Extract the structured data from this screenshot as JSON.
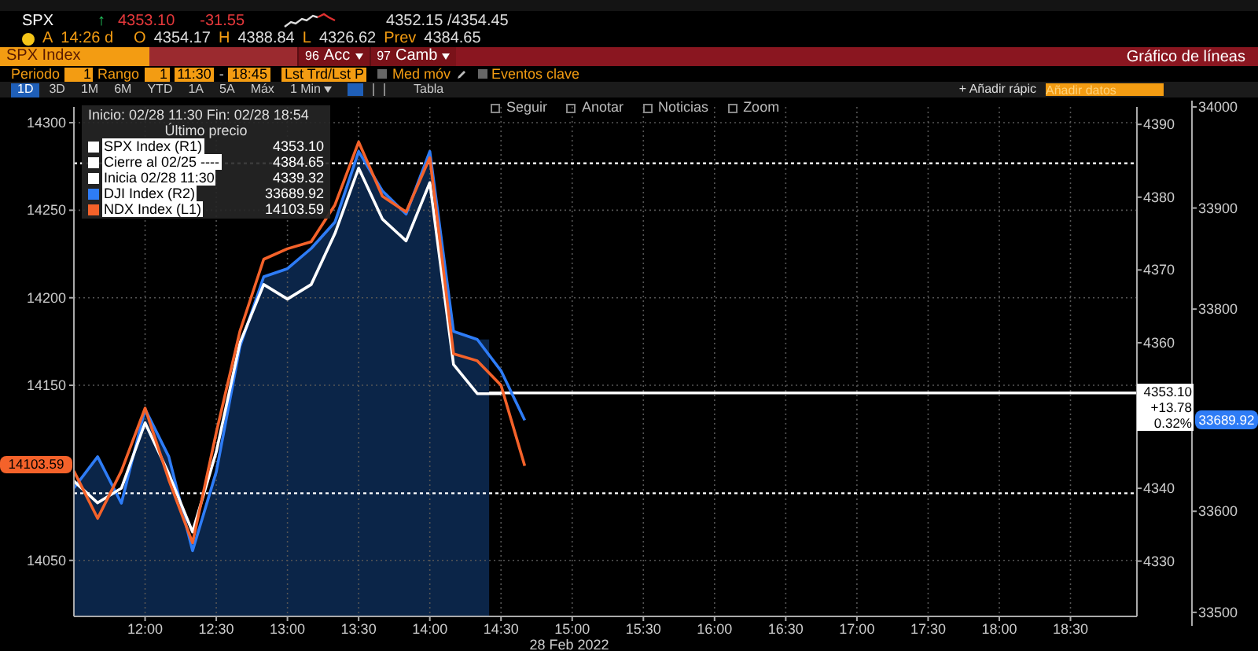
{
  "quote": {
    "ticker": "SPX",
    "arrow": "↑",
    "last": "4353.10",
    "change": "-31.55",
    "bid_ask": "4352.15 /4354.45"
  },
  "quote_details": {
    "source": "A",
    "time": "14:26 d",
    "fields": [
      {
        "label": "O",
        "value": "4354.17"
      },
      {
        "label": "H",
        "value": "4388.84"
      },
      {
        "label": "L",
        "value": "4326.62"
      },
      {
        "label": "Prev",
        "value": "4384.65"
      }
    ]
  },
  "command_bar": {
    "security": "SPX Index",
    "menus": [
      {
        "number": "96",
        "label": "Acc"
      },
      {
        "number": "97",
        "label": "Camb"
      }
    ],
    "title": "Gráfico de líneas"
  },
  "settings": {
    "period_label": "Periodo",
    "period": "1",
    "range_label": "Rango",
    "range": "1",
    "start": "11:30",
    "separator": "-",
    "end": "18:45",
    "price_type": "Lst Trd/Lst P",
    "options": [
      {
        "label": "Med móv",
        "checked": false,
        "kind": "edit"
      },
      {
        "label": "Eventos clave",
        "checked": false,
        "kind": "plain"
      }
    ]
  },
  "timeframes": [
    {
      "label": "1D",
      "selected": true
    },
    {
      "label": "3D",
      "selected": false
    },
    {
      "label": "1M",
      "selected": false
    },
    {
      "label": "6M",
      "selected": false
    },
    {
      "label": "YTD",
      "selected": false
    },
    {
      "label": "1A",
      "selected": false
    },
    {
      "label": "5A",
      "selected": false
    },
    {
      "label": "Máx",
      "selected": false
    }
  ],
  "interval": "1 Min",
  "table_button": "Tabla",
  "quick_add": {
    "label": "+ Añadir rápic",
    "placeholder": "Añadir datos"
  },
  "chart_tools": [
    "Seguir",
    "Anotar",
    "Noticias",
    "Zoom"
  ],
  "legend": {
    "range": "Inicio: 02/28 11:30 Fin: 02/28 18:54",
    "heading": "Último precio",
    "items": [
      {
        "label": "SPX Index (R1)",
        "value": "4353.10",
        "color": "#ffffff"
      },
      {
        "label": "Cierre al 02/25 ----",
        "value": "4384.65",
        "color": "#ffffff"
      },
      {
        "label": "Inicia 02/28 11:30",
        "value": "4339.32",
        "color": "#ffffff"
      },
      {
        "label": "DJI Index (R2)",
        "value": "33689.92",
        "color": "#2e7cf6"
      },
      {
        "label": "NDX Index (L1)",
        "value": "14103.59",
        "color": "#f4622a"
      }
    ]
  },
  "chart": {
    "chart_data": {
      "type": "line",
      "xlabel": "28 Feb 2022",
      "categories": [
        null,
        null,
        null,
        "12:00",
        null,
        null,
        "12:30",
        null,
        null,
        "13:00",
        null,
        null,
        "13:30",
        null,
        null,
        "14:00",
        null,
        null,
        "14:30",
        null,
        null,
        "15:00",
        null,
        null,
        "15:30",
        null,
        null,
        "16:00",
        null,
        null,
        "16:30",
        null,
        null,
        "17:00",
        null,
        null,
        "17:30",
        null,
        null,
        "18:00",
        null,
        null,
        "18:30",
        null,
        null
      ],
      "ylim": [
        14018,
        14309
      ],
      "yticks": [
        14300,
        14250,
        14200,
        14150,
        14050
      ],
      "y2lim": [
        4322.4,
        4392.4
      ],
      "y2ticks": [
        4390,
        4380,
        4370,
        4360,
        4340,
        4330
      ],
      "y3lim": [
        33496,
        34000
      ],
      "y3ticks": [
        34000,
        33900,
        33800,
        33600,
        33500
      ],
      "grid": true,
      "ref_lines": [
        {
          "axis": "y2",
          "value": 4384.65
        },
        {
          "axis": "y2",
          "value": 4339.32
        },
        {
          "axis": "y2",
          "value": 4353.1
        }
      ],
      "series": [
        {
          "color": "#f4622a",
          "values": [
            14101,
            14074,
            14101,
            14137,
            14096,
            14060,
            14123,
            14181,
            14222,
            14228,
            14232,
            14253,
            14289,
            14258,
            14249,
            14280,
            14168,
            14164,
            14150,
            14104,
            null,
            null,
            null,
            null,
            null,
            null,
            null,
            null,
            null,
            null,
            null,
            null,
            null,
            null,
            null,
            null,
            null,
            null,
            null,
            null,
            null,
            null,
            null,
            null,
            null
          ]
        },
        {
          "axis": "y2",
          "color": "#ffffff",
          "values": [
            4341,
            4338,
            4340,
            4349,
            4342,
            4334,
            4345,
            4360,
            4368,
            4366,
            4368,
            4375,
            4384,
            4377,
            4374,
            4382,
            4357,
            4353,
            4353,
            null,
            null,
            null,
            null,
            null,
            null,
            null,
            null,
            null,
            null,
            null,
            null,
            null,
            null,
            null,
            null,
            null,
            null,
            null,
            null,
            null,
            null,
            null,
            null,
            null,
            null
          ]
        },
        {
          "axis": "y3",
          "color": "#2e7cf6",
          "values": [
            33623,
            33654,
            33608,
            33701,
            33654,
            33561,
            33639,
            33763,
            33832,
            33840,
            33860,
            33886,
            33956,
            33917,
            33894,
            33956,
            33778,
            33770,
            33739,
            33690,
            null,
            null,
            null,
            null,
            null,
            null,
            null,
            null,
            null,
            null,
            null,
            null,
            null,
            null,
            null,
            null,
            null,
            null,
            null,
            null,
            null,
            null,
            null,
            null,
            null
          ]
        }
      ]
    },
    "price_tags": [
      {
        "lines": [
          "14103.59"
        ]
      },
      {
        "lines": [
          "4353.10",
          "+13.78",
          "0.32%"
        ]
      },
      {
        "lines": [
          "33689.92"
        ]
      }
    ]
  }
}
